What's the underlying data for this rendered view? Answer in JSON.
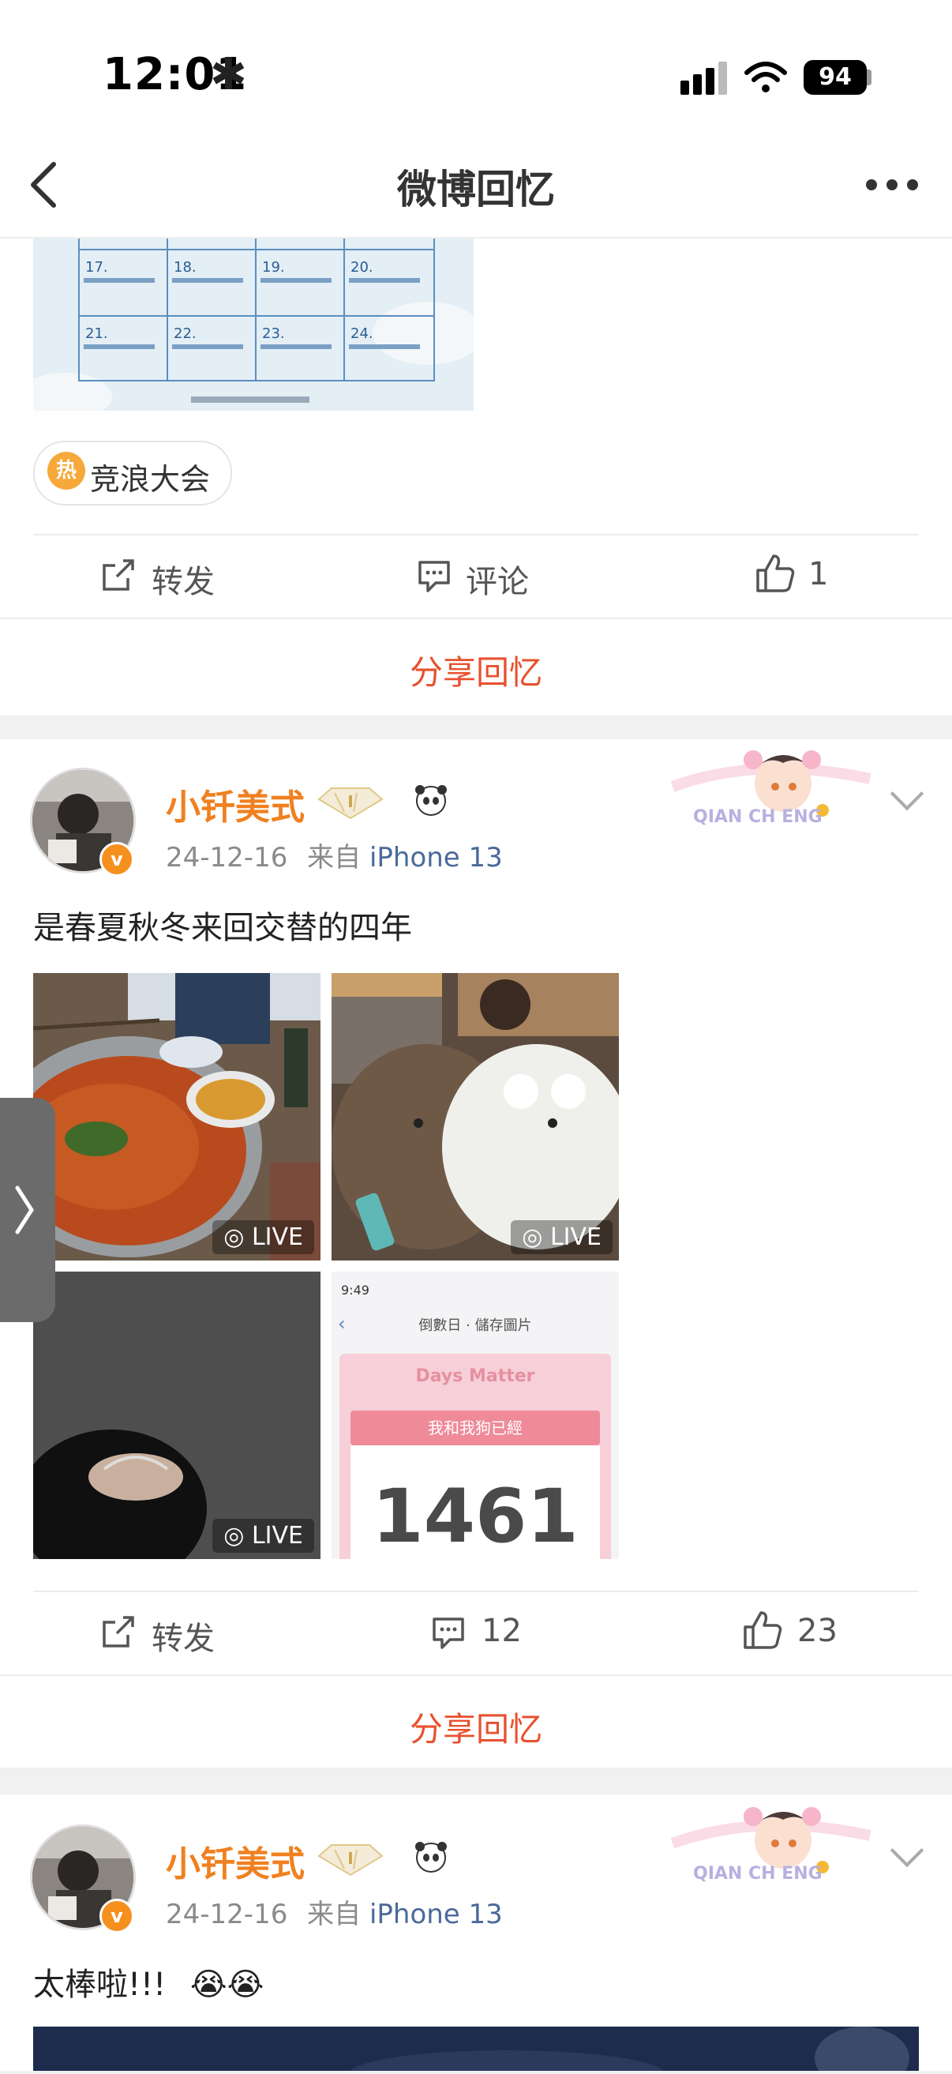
{
  "status": {
    "time": "12:01",
    "battery": "94"
  },
  "nav": {
    "title": "微博回忆"
  },
  "post0": {
    "calendar_cells": [
      "17.",
      "18.",
      "19.",
      "20.",
      "21.",
      "22.",
      "23.",
      "24."
    ],
    "topic": "竞浪大会",
    "hot_label": "热",
    "actions": {
      "repost": "转发",
      "comment": "评论",
      "like": "1"
    },
    "share": "分享回忆"
  },
  "post1": {
    "username": "小钎美式",
    "date": "24-12-16",
    "from_label": "来自",
    "device": "iPhone 13",
    "text": "是春夏秋冬来回交替的四年",
    "live_label": "LIVE",
    "app_title": "倒數日 · 儲存圖片",
    "app_brand": "Days Matter",
    "app_banner": "我和我狗已經",
    "app_number": "1461",
    "actions": {
      "repost": "转发",
      "comment": "12",
      "like": "23"
    },
    "share": "分享回忆",
    "sticker_text": "QIAN CH   ENG",
    "v_badge": "v"
  },
  "post2": {
    "username": "小钎美式",
    "date": "24-12-16",
    "from_label": "来自",
    "device": "iPhone 13",
    "text": "太棒啦!!!",
    "emoji": "😭😭",
    "sticker_text": "QIAN CH   ENG",
    "v_badge": "v"
  },
  "colors": {
    "accent": "#e8512f",
    "username": "#f08020",
    "vip_badge": "#f5901e",
    "link": "#4a6a9a"
  }
}
